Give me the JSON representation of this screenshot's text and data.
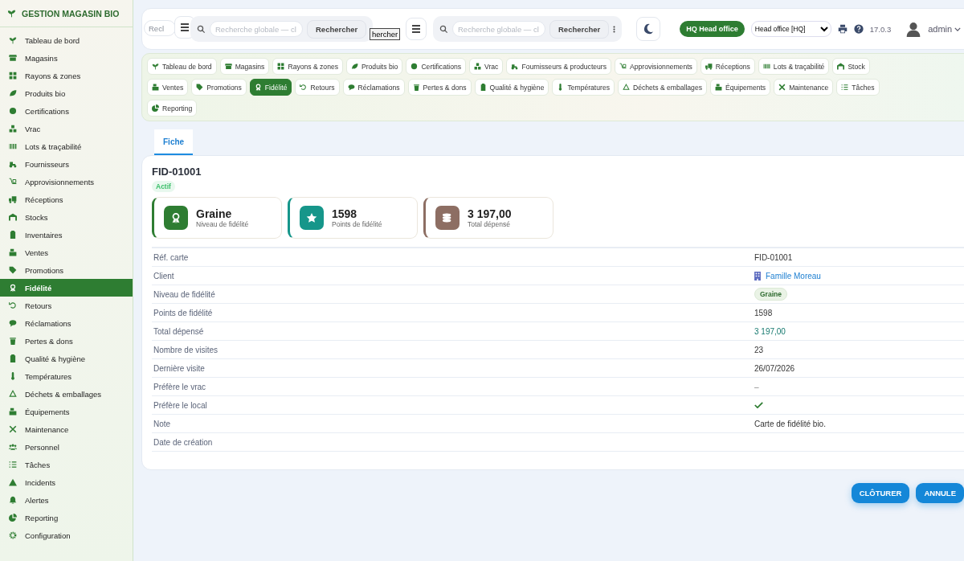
{
  "app": {
    "title": "GESTION MAGASIN BIO"
  },
  "sidebar": {
    "items": [
      {
        "label": "Tableau de bord",
        "selected": false
      },
      {
        "label": "Magasins",
        "selected": false
      },
      {
        "label": "Rayons & zones",
        "selected": false
      },
      {
        "label": "Produits bio",
        "selected": false
      },
      {
        "label": "Certifications",
        "selected": false
      },
      {
        "label": "Vrac",
        "selected": false
      },
      {
        "label": "Lots & traçabilité",
        "selected": false
      },
      {
        "label": "Fournisseurs",
        "selected": false
      },
      {
        "label": "Approvisionnements",
        "selected": false
      },
      {
        "label": "Réceptions",
        "selected": false
      },
      {
        "label": "Stocks",
        "selected": false
      },
      {
        "label": "Inventaires",
        "selected": false
      },
      {
        "label": "Ventes",
        "selected": false
      },
      {
        "label": "Promotions",
        "selected": false
      },
      {
        "label": "Fidélité",
        "selected": true
      },
      {
        "label": "Retours",
        "selected": false
      },
      {
        "label": "Réclamations",
        "selected": false
      },
      {
        "label": "Pertes & dons",
        "selected": false
      },
      {
        "label": "Qualité & hygiène",
        "selected": false
      },
      {
        "label": "Températures",
        "selected": false
      },
      {
        "label": "Déchets & emballages",
        "selected": false
      },
      {
        "label": "Équipements",
        "selected": false
      },
      {
        "label": "Maintenance",
        "selected": false
      },
      {
        "label": "Personnel",
        "selected": false
      },
      {
        "label": "Tâches",
        "selected": false
      },
      {
        "label": "Incidents",
        "selected": false
      },
      {
        "label": "Alertes",
        "selected": false
      },
      {
        "label": "Reporting",
        "selected": false
      },
      {
        "label": "Configuration",
        "selected": false
      }
    ]
  },
  "header": {
    "search_back": {
      "placeholder": "Recl"
    },
    "search": {
      "placeholder": "Recherche globale — cl",
      "button": "Rechercher"
    },
    "hidden_button": "hercher",
    "search_2": {
      "placeholder": "Recherche globale — cl",
      "button": "Rechercher"
    },
    "office_badge": "HQ Head office",
    "office_select": "Head office [HQ]",
    "version": "17.0.3",
    "user": "admin"
  },
  "nav": {
    "rows": [
      {
        "items": [
          {
            "label": "Tableau de bord",
            "selected": false
          },
          {
            "label": "Magasins",
            "selected": false
          },
          {
            "label": "Rayons & zones",
            "selected": false
          },
          {
            "label": "Produits bio",
            "selected": false
          },
          {
            "label": "Certifications",
            "selected": false
          },
          {
            "label": "Vrac",
            "selected": false
          },
          {
            "label": "Fournisseurs & producteurs",
            "selected": false
          },
          {
            "label": "Approvisionnements",
            "selected": false
          },
          {
            "label": "Réceptions",
            "selected": false
          },
          {
            "label": "Lots & traçabilité",
            "selected": false
          },
          {
            "label": "Stock",
            "selected": false
          }
        ]
      },
      {
        "items": [
          {
            "label": "Ventes",
            "selected": false
          },
          {
            "label": "Promotions",
            "selected": false
          },
          {
            "label": "Fidélité",
            "selected": true
          },
          {
            "label": "Retours",
            "selected": false
          },
          {
            "label": "Réclamations",
            "selected": false
          },
          {
            "label": "Pertes & dons",
            "selected": false
          },
          {
            "label": "Qualité & hygiène",
            "selected": false
          },
          {
            "label": "Températures",
            "selected": false
          },
          {
            "label": "Déchets & emballages",
            "selected": false
          },
          {
            "label": "Équipements",
            "selected": false
          },
          {
            "label": "Maintenance",
            "selected": false
          },
          {
            "label": "Tâches",
            "selected": false
          }
        ]
      },
      {
        "items": [
          {
            "label": "Reporting",
            "selected": false
          }
        ]
      }
    ]
  },
  "tabs": [
    {
      "label": "Fiche",
      "selected": true
    }
  ],
  "record": {
    "title": "FID-01001",
    "status": "Actif",
    "stats": [
      {
        "value": "Graine",
        "label": "Niveau de fidélité",
        "color": "#2e7d32"
      },
      {
        "value": "1598",
        "label": "Points de fidélité",
        "color": "#16968a"
      },
      {
        "value": "3 197,00",
        "label": "Total dépensé",
        "color": "#8d6e63"
      }
    ],
    "fields": [
      {
        "label": "Réf. carte",
        "kind": "text",
        "value": "FID-01001"
      },
      {
        "label": "Client",
        "kind": "link",
        "value": "Famille Moreau"
      },
      {
        "label": "Niveau de fidélité",
        "kind": "tag",
        "value": "Graine"
      },
      {
        "label": "Points de fidélité",
        "kind": "text",
        "value": "1598"
      },
      {
        "label": "Total dépensé",
        "kind": "amount",
        "value": "3 197,00"
      },
      {
        "label": "Nombre de visites",
        "kind": "text",
        "value": "23"
      },
      {
        "label": "Dernière visite",
        "kind": "text",
        "value": "26/07/2026"
      },
      {
        "label": "Préfère le vrac",
        "kind": "muted",
        "value": "–"
      },
      {
        "label": "Préfère le local",
        "kind": "check",
        "checked": true
      },
      {
        "label": "Note",
        "kind": "text",
        "value": "Carte de fidélité bio."
      },
      {
        "label": "Date de création",
        "kind": "text"
      }
    ]
  },
  "actions": [
    "CLÔTURER",
    "ANNULE"
  ]
}
